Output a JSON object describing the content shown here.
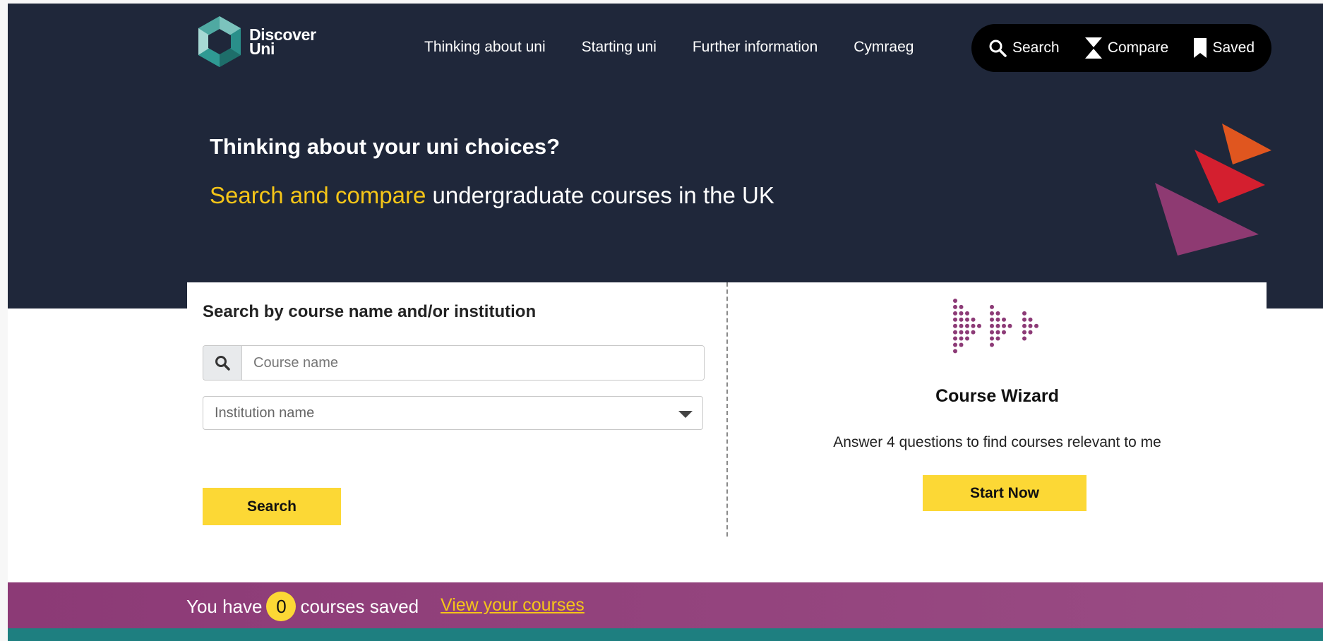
{
  "brand": {
    "logo_line1": "Discover",
    "logo_line2": "Uni"
  },
  "nav": {
    "items": [
      "Thinking about uni",
      "Starting uni",
      "Further information",
      "Cymraeg"
    ]
  },
  "tools": {
    "search": "Search",
    "compare": "Compare",
    "saved": "Saved"
  },
  "hero": {
    "title": "Thinking about your uni choices?",
    "subtitle_accent": "Search and compare",
    "subtitle_rest": " undergraduate courses in the UK"
  },
  "search_panel": {
    "title": "Search by course name and/or institution",
    "course_placeholder": "Course name",
    "institution_placeholder": "Institution name",
    "search_button": "Search"
  },
  "wizard": {
    "title": "Course Wizard",
    "description": "Answer 4 questions to find courses relevant to me",
    "start_button": "Start Now"
  },
  "saved_bar": {
    "prefix": "You have",
    "count": "0",
    "suffix": "courses saved",
    "link": "View your courses"
  },
  "colors": {
    "navy": "#1f273a",
    "yellow": "#fcd835",
    "accent_text": "#f5c518",
    "purple": "#8c3a76",
    "teal": "#1e7f80"
  }
}
